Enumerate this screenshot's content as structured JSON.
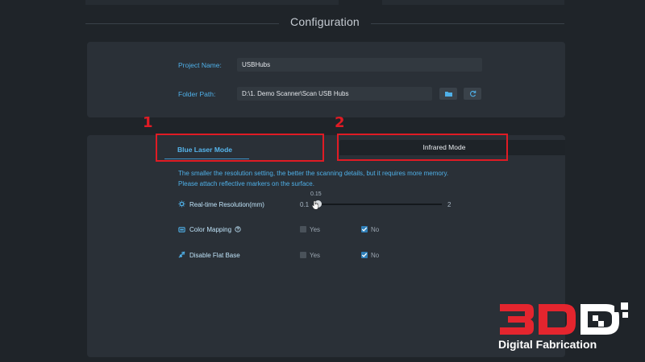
{
  "header": {
    "title": "Configuration"
  },
  "project": {
    "name_label": "Project Name:",
    "name_value": "USBHubs",
    "folder_label": "Folder Path:",
    "folder_value": "D:\\1. Demo Scanner\\Scan USB Hubs"
  },
  "tabs": {
    "blue_laser": "Blue Laser Mode",
    "infrared": "Infrared Mode"
  },
  "annotations": {
    "one": "1",
    "two": "2"
  },
  "hints": {
    "line1": "The smaller the resolution setting, the better the scanning details, but it requires more memory.",
    "line2": "Please attach reflective markers on the surface."
  },
  "resolution": {
    "label": "Real-time Resolution(mm)",
    "min": "0.1",
    "max": "2",
    "current": "0.15",
    "value": 0.15
  },
  "color_mapping": {
    "label": "Color Mapping",
    "yes": "Yes",
    "no": "No",
    "selected": "No"
  },
  "flat_base": {
    "label": "Disable Flat Base",
    "yes": "Yes",
    "no": "No",
    "selected": "No"
  },
  "watermark": {
    "brand": "3D",
    "subtitle": "Digital Fabrication"
  },
  "colors": {
    "accent": "#4fb0e8",
    "annotation": "#e01b24",
    "panel": "#2a3037",
    "background": "#1f2429"
  }
}
